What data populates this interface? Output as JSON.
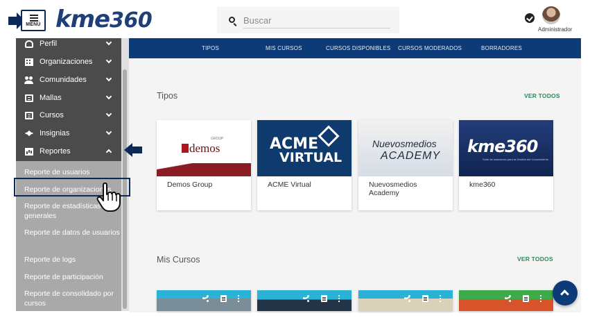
{
  "header": {
    "menu_label": "MENÚ",
    "logo_main": "kme",
    "logo_num": "360",
    "search_placeholder": "Buscar",
    "user_name": "Administrador"
  },
  "topnav": {
    "tabs": [
      "TIPOS",
      "MIS CURSOS",
      "CURSOS DISPONIBLES",
      "CURSOS MODERADOS",
      "BORRADORES"
    ]
  },
  "sidebar": {
    "items": [
      {
        "label": "Perfil",
        "icon": "person-icon"
      },
      {
        "label": "Organizaciones",
        "icon": "building-icon"
      },
      {
        "label": "Comunidades",
        "icon": "group-icon"
      },
      {
        "label": "Mallas",
        "icon": "book-icon"
      },
      {
        "label": "Cursos",
        "icon": "book-icon"
      },
      {
        "label": "Insignias",
        "icon": "star-icon"
      },
      {
        "label": "Reportes",
        "icon": "chart-icon"
      }
    ],
    "sub_items": [
      "Reporte de usuarios",
      "Reporte de organizaciones",
      "Reporte de estadísticas generales",
      "Reporte de datos de usuarios",
      "Reporte de logs",
      "Reporte de participación",
      "Reporte de consolidado por cursos"
    ]
  },
  "main": {
    "tipos_title": "Tipos",
    "tipos_see_all": "VER TODOS",
    "cards": [
      {
        "name": "Demos Group",
        "image_text": "demos",
        "image_sub": "GROUP"
      },
      {
        "name": "ACME Virtual",
        "image_text": "ACME",
        "image_sub": "VIRTUAL"
      },
      {
        "name": "Nuevosmedios Academy",
        "image_text": "Nuevosmedios",
        "image_sub": "ACADEMY"
      },
      {
        "name": "kme360",
        "image_text": "kme360",
        "image_sub": "Suite de soluciones para la Gestión del Conocimiento"
      }
    ],
    "mis_cursos_title": "Mis Cursos",
    "mis_cursos_see_all": "VER TODOS"
  },
  "colors": {
    "brand_blue": "#0d3b78",
    "accent_green": "#2a8a5a",
    "sidebar_dark": "#4b4b4b",
    "sidebar_light": "#a9a9a9"
  }
}
